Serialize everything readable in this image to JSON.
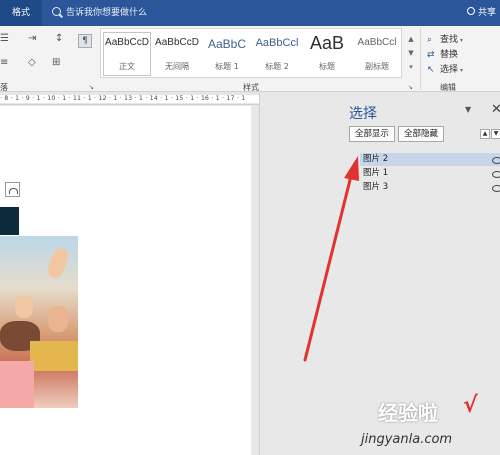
{
  "tabbar": {
    "tab_format": "格式",
    "tell_me": "告诉我你想要做什么",
    "share": "共享"
  },
  "ribbon": {
    "left_group_label": "落",
    "styles_group_label": "样式",
    "editing_group_label": "编辑",
    "styles": [
      {
        "preview": "AaBbCcD",
        "name": "正文"
      },
      {
        "preview": "AaBbCcD",
        "name": "无间隔"
      },
      {
        "preview": "AaBbC",
        "name": "标题 1"
      },
      {
        "preview": "AaBbCcl",
        "name": "标题 2"
      },
      {
        "preview": "AaB",
        "name": "标题"
      },
      {
        "preview": "AaBbCcl",
        "name": "副标题"
      }
    ],
    "editing": {
      "find": "查找",
      "replace": "替换",
      "select": "选择"
    }
  },
  "ruler": {
    "text": "· 8 · 1 · 9 · 1 · 10 · 1 · 11 · 1 · 12 · 1 · 13 · 1 · 14 · 1 · 15 · 1 · 16 · 1 · 17 · 1"
  },
  "pane": {
    "title": "选择",
    "show_all": "全部显示",
    "hide_all": "全部隐藏",
    "objects": [
      {
        "name": "图片 2",
        "selected": true
      },
      {
        "name": "图片 1",
        "selected": false
      },
      {
        "name": "图片 3",
        "selected": false
      }
    ]
  },
  "watermark": {
    "cn": "经验啦",
    "check": "√",
    "url": "jingyanla.com"
  },
  "colors": {
    "title_bar": "#2b579a",
    "accent": "#2b579a",
    "selected_row": "#c6d5ea",
    "annotation_arrow": "#e0322f"
  }
}
